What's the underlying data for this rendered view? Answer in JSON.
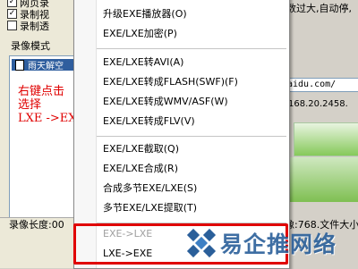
{
  "background_window": {
    "checkboxes": [
      {
        "label": "网页录",
        "checked": true
      },
      {
        "label": "录制视",
        "checked": true
      },
      {
        "label": "录制透",
        "checked": false
      }
    ],
    "section_label": "录像模式",
    "list_item": "雨天解空",
    "annotation": "右键点击\n选择\nLXE ->EXE",
    "status_left": "录像长度:00",
    "right_top_text": "数过大,自动停,",
    "url_text": "aidu.com/",
    "ip_text": "168.20.2458.",
    "status_right": "像:768.文件大小"
  },
  "context_menu": {
    "items": [
      {
        "label": "升级EXE播放器(O)",
        "disabled": false
      },
      {
        "label": "EXE/LXE加密(P)",
        "disabled": false
      },
      {
        "separator": true
      },
      {
        "label": "EXE/LXE转AVI(A)",
        "disabled": false
      },
      {
        "label": "EXE/LXE转成FLASH(SWF)(F)",
        "disabled": false
      },
      {
        "label": "EXE/LXE转成WMV/ASF(W)",
        "disabled": false
      },
      {
        "label": "EXE/LXE转成FLV(V)",
        "disabled": false
      },
      {
        "separator": true
      },
      {
        "label": "EXE/LXE截取(Q)",
        "disabled": false
      },
      {
        "label": "EXE/LXE合成(R)",
        "disabled": false
      },
      {
        "label": "合成多节EXE/LXE(S)",
        "disabled": false
      },
      {
        "label": "多节EXE/LXE提取(T)",
        "disabled": false
      },
      {
        "separator": true
      },
      {
        "label": "EXE->LXE",
        "disabled": true
      },
      {
        "label": "LXE->EXE",
        "disabled": false
      }
    ]
  },
  "watermark": {
    "text": "易企推网络"
  },
  "colors": {
    "highlight": "#e00000",
    "annotation": "#e00000",
    "selection": "#2f5e9e",
    "watermark": "#2a5f9a"
  }
}
